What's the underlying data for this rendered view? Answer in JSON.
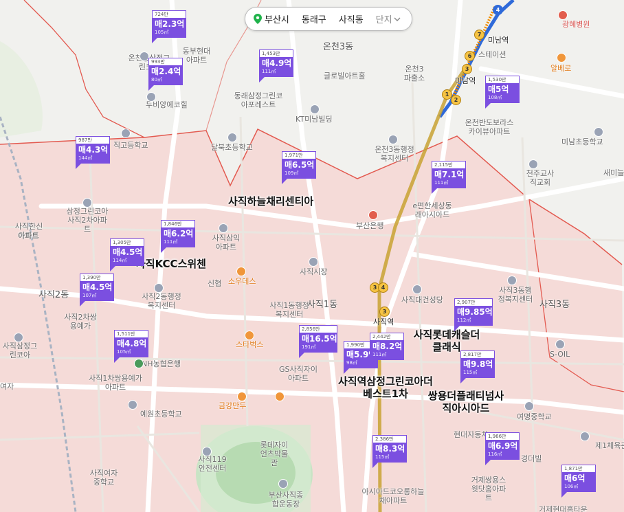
{
  "breadcrumb": {
    "city": "부산시",
    "district": "동래구",
    "dong": "사직동",
    "complex": "단지"
  },
  "colors": {
    "marker": "#7b4fe0",
    "region_fill": "#f7d9d6",
    "region_border": "#e35a50",
    "subway_line1": "#f08c00",
    "subway_line3": "#c8a233",
    "subway_line4": "#2f6ad9"
  },
  "icons": [
    "location-pin-icon",
    "chevron-down-icon",
    "school-icon",
    "building-icon",
    "hospital-icon",
    "cafe-icon",
    "restaurant-icon",
    "bank-icon",
    "subway-icon"
  ],
  "labels": {
    "dongs": [
      "온천3동",
      "사직1동",
      "사직2동",
      "사직3동"
    ],
    "places": [
      "미남역",
      "광혜병원",
      "온천동삼정그린코아",
      "동부현대아파트",
      "두비앙에코힐",
      "동래삼정그린코아포레스트",
      "글로빌아트홀",
      "온천3파출소",
      "KT미남빌딩",
      "온천반도보라스카이뷰아파트",
      "미남초등학교",
      "천주교사직교회",
      "새미늘",
      "달북초등학교",
      "직고등학교",
      "온천3동행정복지센터",
      "e편한세상동래아시아드",
      "삼정그린코아사직2차아파트",
      "사직한신아파트",
      "사직삼익아파트",
      "부산은행",
      "사직2동행정복지센터",
      "신협",
      "소우데스",
      "사직시장",
      "사직대건성당",
      "사직3동행정복지센터",
      "사직1동행정복지센터",
      "사직2차쌍용예가",
      "사직삼정그린코아",
      "사직1차쌍용예가아파트",
      "NH농협은행",
      "스타벅스",
      "GS사직자이아파트",
      "S-OIL",
      "예원초등학교",
      "금강만두",
      "롯데자이언츠박물관",
      "사직119안전센터",
      "사직여자중학교",
      "사직역",
      "현대자동차",
      "여명중학교",
      "경더빌",
      "제1체육관",
      "거제쌍용스윗닷홈아파트",
      "부산사직종합운동장",
      "아시아드코오롱하늘채아파트",
      "거제현대홈타운",
      "알베로",
      "미남역",
      "스테이션",
      "여자",
      "아파트"
    ],
    "complexes": [
      "사직하늘채리센티아",
      "사직KCC스위첸",
      "사직롯데캐슬더클래식",
      "사직역삼정그린코아더베스트1차",
      "쌍용더플래티넘사직아시아드"
    ]
  },
  "markers": [
    {
      "unit": "724만",
      "price": "매2.3억",
      "area": "105㎡"
    },
    {
      "unit": "993만",
      "price": "매2.4억",
      "area": "80㎡"
    },
    {
      "unit": "1,453만",
      "price": "매4.9억",
      "area": "111㎡"
    },
    {
      "unit": "1,530만",
      "price": "매5억",
      "area": "108㎡"
    },
    {
      "unit": "987만",
      "price": "매4.3억",
      "area": "144㎡"
    },
    {
      "unit": "1,971만",
      "price": "매6.5억",
      "area": "109㎡"
    },
    {
      "unit": "2,115만",
      "price": "매7.1억",
      "area": "111㎡"
    },
    {
      "unit": "1,846만",
      "price": "매6.2억",
      "area": "111㎡"
    },
    {
      "unit": "1,305만",
      "price": "매4.5억",
      "area": "114㎡"
    },
    {
      "unit": "1,390만",
      "price": "매4.5억",
      "area": "107㎡"
    },
    {
      "unit": "1,511만",
      "price": "매4.8억",
      "area": "105㎡"
    },
    {
      "unit": "2,856만",
      "price": "매16.5억",
      "area": "191㎡"
    },
    {
      "unit": "1,990만",
      "price": "매5.9억",
      "area": "98㎡"
    },
    {
      "unit": "2,442만",
      "price": "매8.2억",
      "area": "111㎡"
    },
    {
      "unit": "2,907만",
      "price": "매9.85억",
      "area": "112㎡"
    },
    {
      "unit": "2,817만",
      "price": "매9.8억",
      "area": "115㎡"
    },
    {
      "unit": "2,386만",
      "price": "매8.3억",
      "area": "115㎡"
    },
    {
      "unit": "1,966만",
      "price": "매6.9억",
      "area": "116㎡"
    },
    {
      "unit": "1,871만",
      "price": "매6억",
      "area": "106㎡"
    }
  ]
}
